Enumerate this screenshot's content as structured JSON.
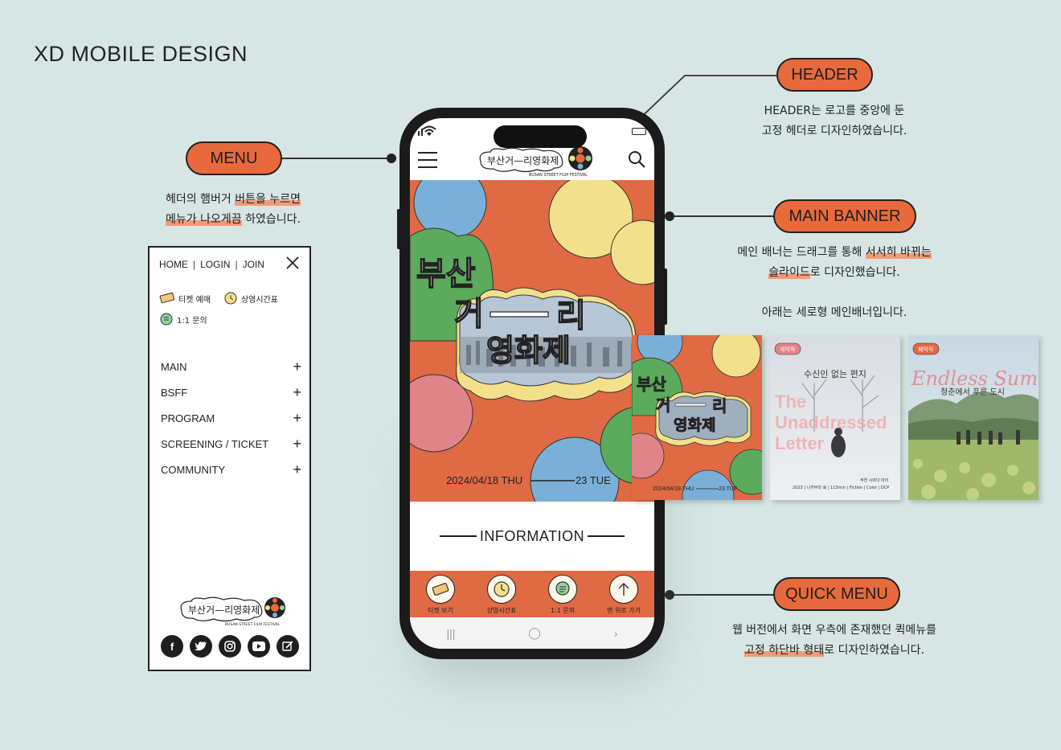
{
  "page_title": "XD MOBILE DESIGN",
  "callouts": {
    "menu": {
      "label": "MENU",
      "desc_line1_a": "헤더의 햄버거 ",
      "desc_line1_hl": "버튼을 누르면",
      "desc_line2_hl": "메뉴가 나오게끔",
      "desc_line2_b": " 하였습니다."
    },
    "header": {
      "label": "HEADER",
      "desc_line1": "HEADER는 로고를 중앙에 둔",
      "desc_line2": "고정 헤더로 디자인하였습니다."
    },
    "main_banner": {
      "label": "MAIN BANNER",
      "desc_line1_a": "메인 배너는 드래그를 통해 ",
      "desc_line1_hl": "서서히 바뀌는",
      "desc_line2_hl": "슬라이드",
      "desc_line2_b": "로 디자인했습니다.",
      "desc_line3": "아래는 세로형 메인배너입니다."
    },
    "quick_menu": {
      "label": "QUICK MENU",
      "desc_line1": "웹 버전에서 화면 우측에 존재했던 퀵메뉴를",
      "desc_line2_hl": "고정 하단바 형태",
      "desc_line2_b": "로 디자인하였습니다."
    }
  },
  "menu_panel": {
    "top_links": [
      "HOME",
      "LOGIN",
      "JOIN"
    ],
    "separator": "|",
    "quick": [
      {
        "label": "티켓 예매",
        "icon": "ticket-icon"
      },
      {
        "label": "상영시간표",
        "icon": "clock-icon"
      },
      {
        "label": "1:1 문의",
        "icon": "chat-icon"
      }
    ],
    "items": [
      "MAIN",
      "BSFF",
      "PROGRAM",
      "SCREENING / TICKET",
      "COMMUNITY"
    ],
    "plus": "+",
    "logo_text": "부산거—리영화제",
    "logo_sub": "BUSAN STREET FILM FESTIVAL",
    "socials": [
      "facebook-icon",
      "twitter-icon",
      "instagram-icon",
      "youtube-icon",
      "blog-icon"
    ]
  },
  "phone": {
    "logo_text": "부산거—리영화제",
    "logo_sub": "BUSAN STREET FILM FESTIVAL",
    "banner": {
      "title_line1": "부산",
      "title_line2a": "거",
      "title_line2b": "리",
      "title_line3": "영화제",
      "date_start": "2024/04/18 THU",
      "date_end": "23 TUE"
    },
    "info_title": "INFORMATION",
    "quick_menu": [
      {
        "label": "티켓 보기",
        "icon": "ticket-icon"
      },
      {
        "label": "상영시간표",
        "icon": "clock-icon"
      },
      {
        "label": "1:1 문의",
        "icon": "chat-icon"
      },
      {
        "label": "맨 위로 가기",
        "icon": "arrow-up-icon"
      }
    ],
    "nav": [
      "|||",
      "◯",
      "›"
    ]
  },
  "thumbnails": [
    {
      "title_line1": "부산",
      "title_line2a": "거",
      "title_line2b": "리",
      "title_line3": "영화제",
      "date_start": "2024/04/18 THU",
      "date_end": "23 TUE"
    },
    {
      "badge": "개막작",
      "title_kr": "수신인 없는 편지",
      "title_en_1": "The",
      "title_en_2": "Unaddressed",
      "title_en_3": "Letter",
      "credit": "주연 시마다 마리",
      "meta": "2023 | 니카무라 료 | 113min | Fiction | Color | DCP"
    },
    {
      "badge": "폐막작",
      "title_en": "Endless Summer",
      "title_kr": "청춘에서 푸른 도시"
    }
  ],
  "colors": {
    "accent": "#e86a3c",
    "background": "#d7e6e4",
    "banner": "#e06a44"
  }
}
